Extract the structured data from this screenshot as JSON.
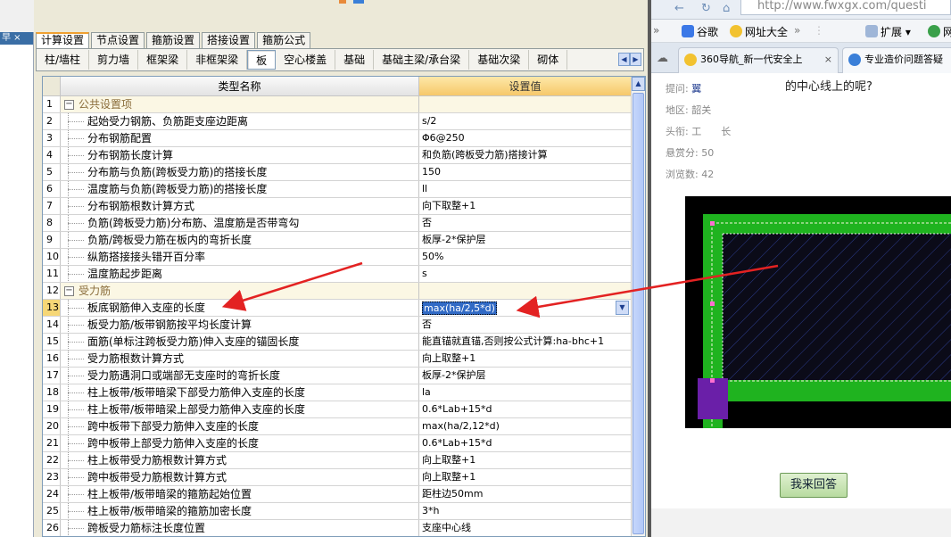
{
  "tabs": [
    {
      "label": "计算设置",
      "active": true
    },
    {
      "label": "节点设置",
      "active": false
    },
    {
      "label": "箍筋设置",
      "active": false
    },
    {
      "label": "搭接设置",
      "active": false
    },
    {
      "label": "箍筋公式",
      "active": false
    }
  ],
  "subtabs": [
    {
      "label": "柱/墙柱",
      "active": false
    },
    {
      "label": "剪力墙",
      "active": false
    },
    {
      "label": "框架梁",
      "active": false
    },
    {
      "label": "非框架梁",
      "active": false
    },
    {
      "label": "板",
      "active": true
    },
    {
      "label": "空心楼盖",
      "active": false
    },
    {
      "label": "基础",
      "active": false
    },
    {
      "label": "基础主梁/承台梁",
      "active": false
    },
    {
      "label": "基础次梁",
      "active": false
    },
    {
      "label": "砌体",
      "active": false
    }
  ],
  "table": {
    "col_name": "类型名称",
    "col_value": "设置值",
    "rows": [
      {
        "n": "1",
        "name": "公共设置项",
        "value": "",
        "group": true
      },
      {
        "n": "2",
        "name": "起始受力钢筋、负筋距支座边距离",
        "value": "s/2"
      },
      {
        "n": "3",
        "name": "分布钢筋配置",
        "value": "Φ6@250"
      },
      {
        "n": "4",
        "name": "分布钢筋长度计算",
        "value": "和负筋(跨板受力筋)搭接计算"
      },
      {
        "n": "5",
        "name": "分布筋与负筋(跨板受力筋)的搭接长度",
        "value": "150"
      },
      {
        "n": "6",
        "name": "温度筋与负筋(跨板受力筋)的搭接长度",
        "value": "ll"
      },
      {
        "n": "7",
        "name": "分布钢筋根数计算方式",
        "value": "向下取整+1"
      },
      {
        "n": "8",
        "name": "负筋(跨板受力筋)分布筋、温度筋是否带弯勾",
        "value": "否"
      },
      {
        "n": "9",
        "name": "负筋/跨板受力筋在板内的弯折长度",
        "value": "板厚-2*保护层"
      },
      {
        "n": "10",
        "name": "纵筋搭接接头错开百分率",
        "value": "50%"
      },
      {
        "n": "11",
        "name": "温度筋起步距离",
        "value": "s"
      },
      {
        "n": "12",
        "name": "受力筋",
        "value": "",
        "group": true
      },
      {
        "n": "13",
        "name": "板底钢筋伸入支座的长度",
        "value": "max(ha/2,5*d)",
        "selected": true
      },
      {
        "n": "14",
        "name": "板受力筋/板带钢筋按平均长度计算",
        "value": "否"
      },
      {
        "n": "15",
        "name": "面筋(单标注跨板受力筋)伸入支座的锚固长度",
        "value": "能直锚就直锚,否则按公式计算:ha-bhc+1"
      },
      {
        "n": "16",
        "name": "受力筋根数计算方式",
        "value": "向上取整+1"
      },
      {
        "n": "17",
        "name": "受力筋遇洞口或端部无支座时的弯折长度",
        "value": "板厚-2*保护层"
      },
      {
        "n": "18",
        "name": "柱上板带/板带暗梁下部受力筋伸入支座的长度",
        "value": "la"
      },
      {
        "n": "19",
        "name": "柱上板带/板带暗梁上部受力筋伸入支座的长度",
        "value": "0.6*Lab+15*d"
      },
      {
        "n": "20",
        "name": "跨中板带下部受力筋伸入支座的长度",
        "value": "max(ha/2,12*d)"
      },
      {
        "n": "21",
        "name": "跨中板带上部受力筋伸入支座的长度",
        "value": "0.6*Lab+15*d"
      },
      {
        "n": "22",
        "name": "柱上板带受力筋根数计算方式",
        "value": "向上取整+1"
      },
      {
        "n": "23",
        "name": "跨中板带受力筋根数计算方式",
        "value": "向上取整+1"
      },
      {
        "n": "24",
        "name": "柱上板带/板带暗梁的箍筋起始位置",
        "value": "距柱边50mm"
      },
      {
        "n": "25",
        "name": "柱上板带/板带暗梁的箍筋加密长度",
        "value": "3*h"
      },
      {
        "n": "26",
        "name": "跨板受力筋标注长度位置",
        "value": "支座中心线"
      }
    ]
  },
  "browser": {
    "url": "http://www.fwxgx.com/questi",
    "bookmarks": [
      "谷歌",
      "网址大全",
      "扩展",
      "网"
    ],
    "tabs": [
      "360导航_新一代安全上",
      "专业造价问题答疑"
    ],
    "question_title": "的中心线上的呢?",
    "fields": [
      {
        "label": "提问:",
        "value": "翼"
      },
      {
        "label": "地区:",
        "value": "韶关"
      },
      {
        "label": "头衔:",
        "value": "工　　长"
      },
      {
        "label": "悬赏分:",
        "value": "50"
      },
      {
        "label": "浏览数:",
        "value": "42"
      }
    ],
    "answer_button": "我来回答"
  },
  "left_strip_label": "早 ×",
  "colors": {
    "accent_tab": "#f0a030",
    "selection": "#316ac5",
    "arrow": "#e32222",
    "drawing_green": "#1fb31f",
    "drawing_purple": "#6a1fa8"
  }
}
